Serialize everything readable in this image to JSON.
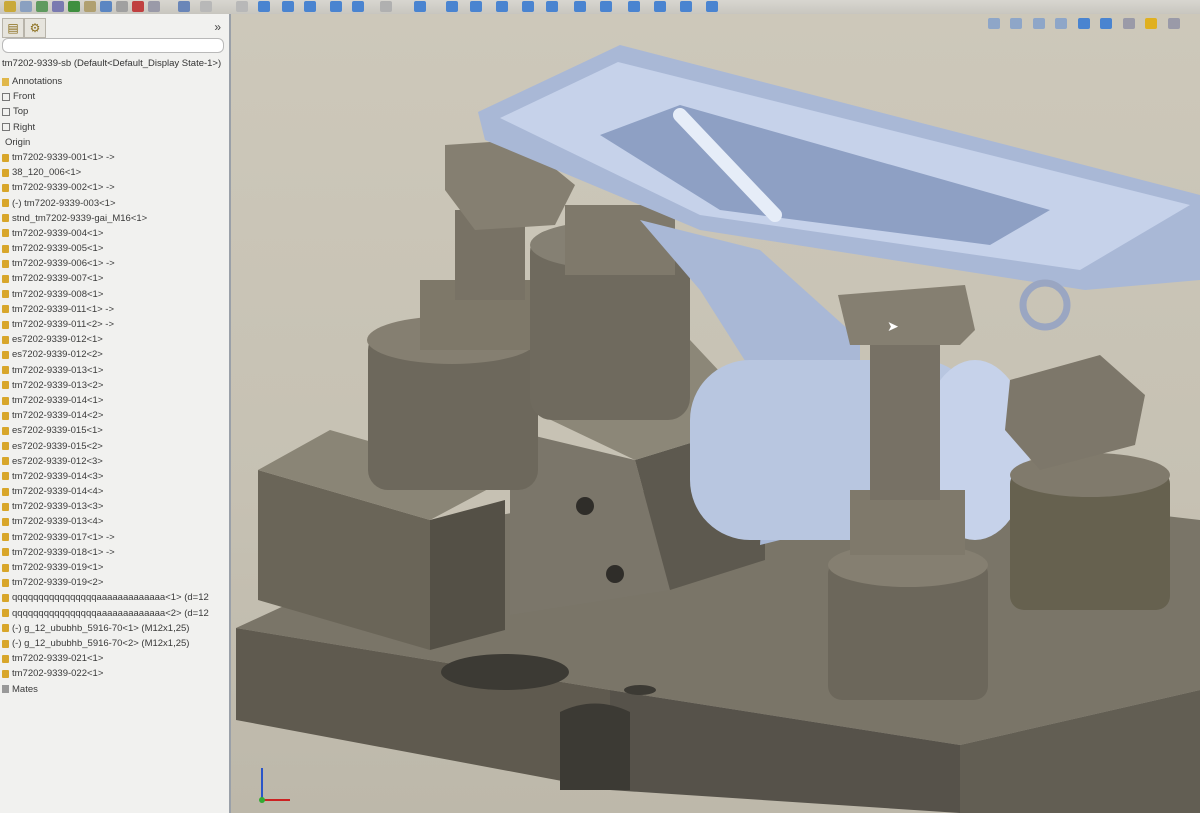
{
  "app": {
    "panel_collapse_glyph": "»",
    "accent": "#d8a62a"
  },
  "feature_tree": {
    "root": "tm7202-9339-sb  (Default<Default_Display State-1>)",
    "items": [
      {
        "label": "Annotations",
        "icon": "annotations-folder-icon"
      },
      {
        "label": "Front",
        "icon": "plane-icon"
      },
      {
        "label": "Top",
        "icon": "plane-icon"
      },
      {
        "label": "Right",
        "icon": "plane-icon"
      },
      {
        "label": "Origin",
        "icon": "origin-icon"
      },
      {
        "label": "tm7202-9339-001<1> ->",
        "icon": "part-icon"
      },
      {
        "label": "38_120_006<1>",
        "icon": "part-icon"
      },
      {
        "label": "tm7202-9339-002<1> ->",
        "icon": "part-icon"
      },
      {
        "label": "(-) tm7202-9339-003<1>",
        "icon": "part-icon"
      },
      {
        "label": "stnd_tm7202-9339-gai_M16<1>",
        "icon": "part-icon"
      },
      {
        "label": "tm7202-9339-004<1>",
        "icon": "part-icon"
      },
      {
        "label": "tm7202-9339-005<1>",
        "icon": "part-icon"
      },
      {
        "label": "tm7202-9339-006<1> ->",
        "icon": "part-icon"
      },
      {
        "label": "tm7202-9339-007<1>",
        "icon": "part-icon"
      },
      {
        "label": "tm7202-9339-008<1>",
        "icon": "part-icon"
      },
      {
        "label": "tm7202-9339-011<1> ->",
        "icon": "part-icon"
      },
      {
        "label": "tm7202-9339-011<2> ->",
        "icon": "part-icon"
      },
      {
        "label": "es7202-9339-012<1>",
        "icon": "part-icon"
      },
      {
        "label": "es7202-9339-012<2>",
        "icon": "part-icon"
      },
      {
        "label": "tm7202-9339-013<1>",
        "icon": "part-icon"
      },
      {
        "label": "tm7202-9339-013<2>",
        "icon": "part-icon"
      },
      {
        "label": "tm7202-9339-014<1>",
        "icon": "part-icon"
      },
      {
        "label": "tm7202-9339-014<2>",
        "icon": "part-icon"
      },
      {
        "label": "es7202-9339-015<1>",
        "icon": "part-icon"
      },
      {
        "label": "es7202-9339-015<2>",
        "icon": "part-icon"
      },
      {
        "label": "es7202-9339-012<3>",
        "icon": "part-icon"
      },
      {
        "label": "tm7202-9339-014<3>",
        "icon": "part-icon"
      },
      {
        "label": "tm7202-9339-014<4>",
        "icon": "part-icon"
      },
      {
        "label": "tm7202-9339-013<3>",
        "icon": "part-icon"
      },
      {
        "label": "tm7202-9339-013<4>",
        "icon": "part-icon"
      },
      {
        "label": "tm7202-9339-017<1> ->",
        "icon": "part-icon"
      },
      {
        "label": "tm7202-9339-018<1> ->",
        "icon": "part-icon"
      },
      {
        "label": "tm7202-9339-019<1>",
        "icon": "part-icon"
      },
      {
        "label": "tm7202-9339-019<2>",
        "icon": "part-icon"
      },
      {
        "label": "qqqqqqqqqqqqqqqqaaaaaaaaaaaaa<1> (d=12",
        "icon": "part-icon"
      },
      {
        "label": "qqqqqqqqqqqqqqqqaaaaaaaaaaaaa<2> (d=12",
        "icon": "part-icon"
      },
      {
        "label": "(-) g_12_ububhb_5916-70<1> (M12x1,25)",
        "icon": "part-icon"
      },
      {
        "label": "(-) g_12_ububhb_5916-70<2> (M12x1,25)",
        "icon": "part-icon"
      },
      {
        "label": "tm7202-9339-021<1>",
        "icon": "part-icon"
      },
      {
        "label": "tm7202-9339-022<1>",
        "icon": "part-icon"
      },
      {
        "label": "Mates",
        "icon": "mates-icon"
      }
    ]
  },
  "colors": {
    "metal": "#6f6a5e",
    "metal_dark": "#4d493f",
    "metal_light": "#8f8a7c",
    "selected_part": "#a9b8d6",
    "selected_part_light": "#c6d2ea",
    "selected_part_dark": "#7f92b6"
  }
}
